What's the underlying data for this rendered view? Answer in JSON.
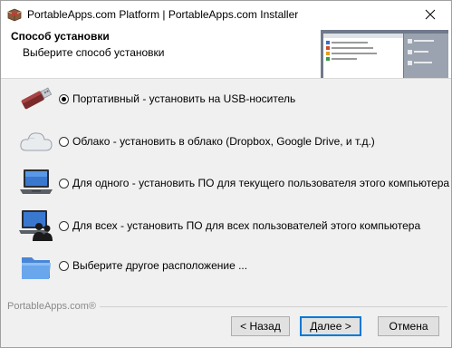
{
  "window": {
    "title": "PortableApps.com Platform | PortableApps.com Installer"
  },
  "header": {
    "title": "Способ установки",
    "subtitle": "Выберите способ установки"
  },
  "options": [
    {
      "icon": "usb-drive-icon",
      "label": "Портативный - установить на USB-носитель",
      "checked": true
    },
    {
      "icon": "cloud-icon",
      "label": "Облако - установить в облако (Dropbox, Google Drive, и т.д.)",
      "checked": false
    },
    {
      "icon": "laptop-icon",
      "label": "Для одного - установить ПО для текущего пользователя этого компьютера",
      "checked": false
    },
    {
      "icon": "laptop-users-icon",
      "label": "Для всех - установить ПО для всех пользователей этого компьютера",
      "checked": false
    },
    {
      "icon": "folder-icon",
      "label": "Выберите другое расположение ...",
      "checked": false
    }
  ],
  "footer": {
    "brand": "PortableApps.com®",
    "back_label": "< Назад",
    "next_label": "Далее >",
    "cancel_label": "Отмена"
  }
}
